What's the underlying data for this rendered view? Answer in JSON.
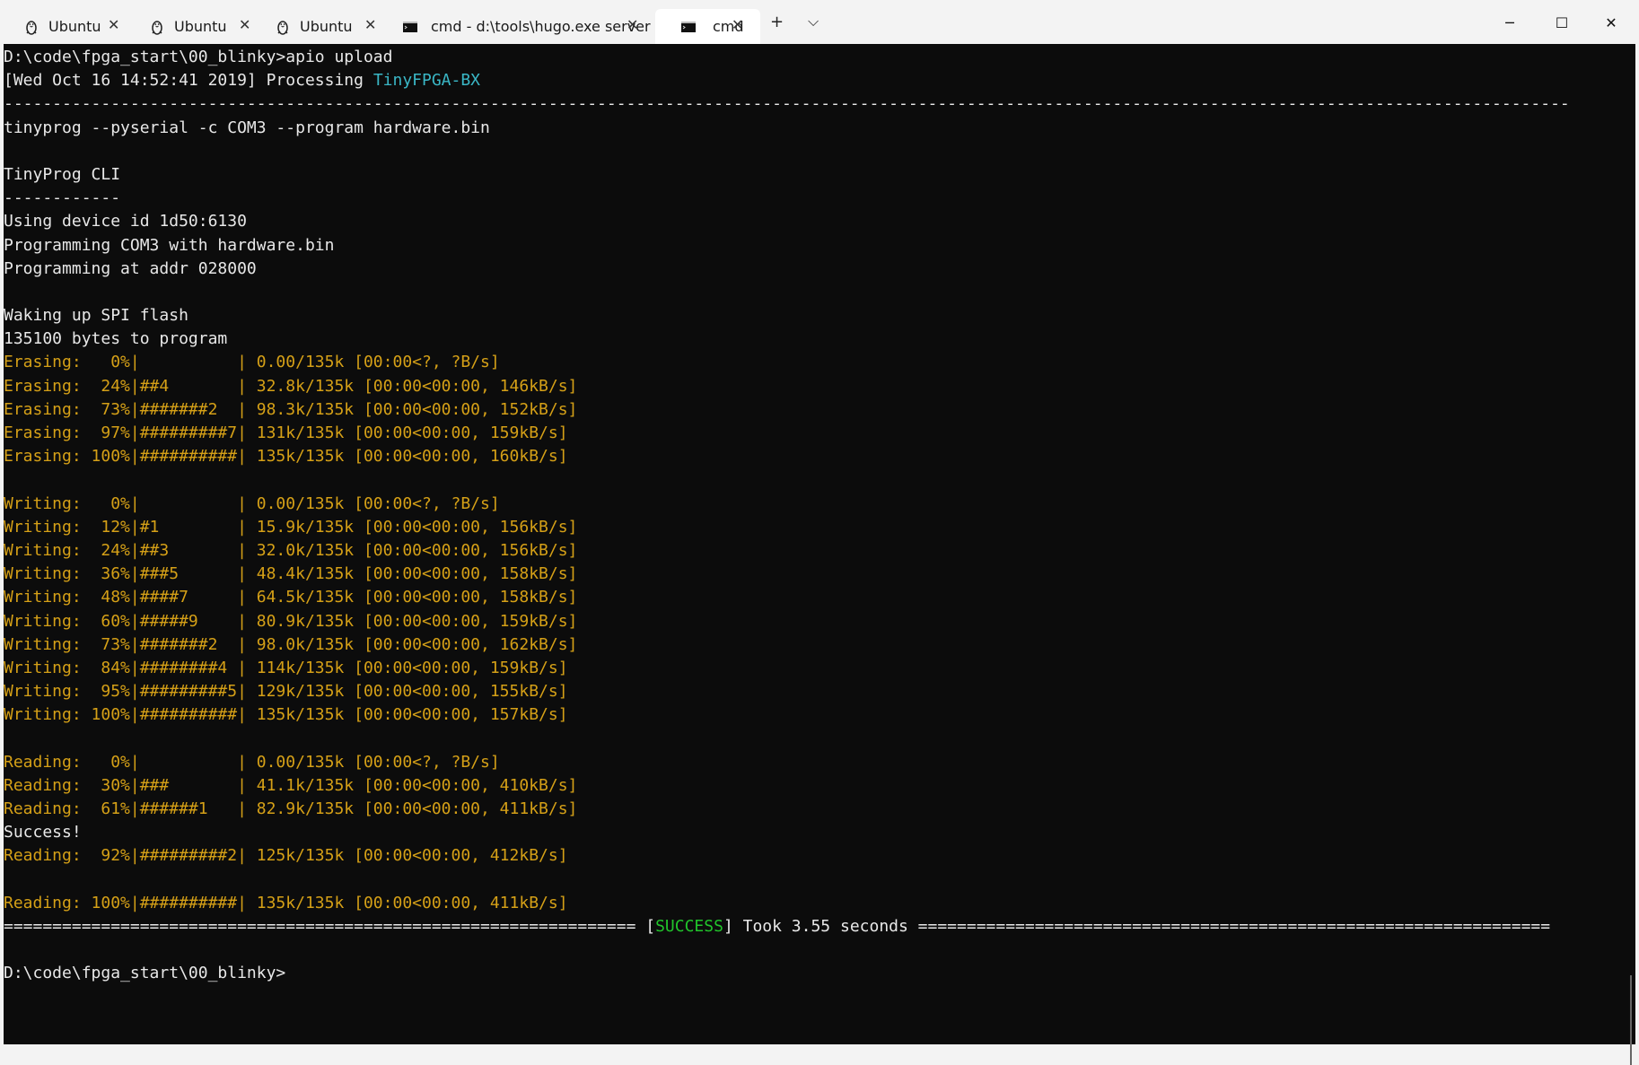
{
  "tabs": [
    {
      "label": "Ubuntu",
      "icon": "linux-penguin-icon"
    },
    {
      "label": "Ubuntu",
      "icon": "linux-penguin-icon"
    },
    {
      "label": "Ubuntu",
      "icon": "linux-penguin-icon"
    },
    {
      "label": "cmd - d:\\tools\\hugo.exe  server",
      "icon": "cmd-console-icon"
    },
    {
      "label": "cmd",
      "icon": "cmd-console-icon",
      "active": true
    }
  ],
  "toolbar": {
    "new_tab": "+",
    "dropdown": "⌵"
  },
  "window_controls": {
    "minimize": "─",
    "maximize": "☐",
    "close": "✕"
  },
  "terminal": {
    "lines": [
      [
        {
          "t": "D:\\code\\fpga_start\\00_blinky>apio upload"
        }
      ],
      [
        {
          "t": "[Wed Oct 16 14:52:41 2019] Processing "
        },
        {
          "t": "TinyFPGA-BX",
          "c": "c"
        }
      ],
      [
        {
          "t": "-----------------------------------------------------------------------------------------------------------------------------------------------------------------"
        }
      ],
      [
        {
          "t": "tinyprog --pyserial -c COM3 --program hardware.bin"
        }
      ],
      [
        {
          "t": ""
        }
      ],
      [
        {
          "t": "TinyProg CLI"
        }
      ],
      [
        {
          "t": "------------"
        }
      ],
      [
        {
          "t": "Using device id 1d50:6130"
        }
      ],
      [
        {
          "t": "Programming COM3 with hardware.bin"
        }
      ],
      [
        {
          "t": "Programming at addr 028000"
        }
      ],
      [
        {
          "t": ""
        }
      ],
      [
        {
          "t": "Waking up SPI flash"
        }
      ],
      [
        {
          "t": "135100 bytes to program"
        }
      ],
      [
        {
          "t": "Erasing:   0%|          | 0.00/135k [00:00<?, ?B/s]",
          "c": "y"
        }
      ],
      [
        {
          "t": "Erasing:  24%|##4       | 32.8k/135k [00:00<00:00, 146kB/s]",
          "c": "y"
        }
      ],
      [
        {
          "t": "Erasing:  73%|#######2  | 98.3k/135k [00:00<00:00, 152kB/s]",
          "c": "y"
        }
      ],
      [
        {
          "t": "Erasing:  97%|#########7| 131k/135k [00:00<00:00, 159kB/s]",
          "c": "y"
        }
      ],
      [
        {
          "t": "Erasing: 100%|##########| 135k/135k [00:00<00:00, 160kB/s]",
          "c": "y"
        }
      ],
      [
        {
          "t": ""
        }
      ],
      [
        {
          "t": "Writing:   0%|          | 0.00/135k [00:00<?, ?B/s]",
          "c": "y"
        }
      ],
      [
        {
          "t": "Writing:  12%|#1        | 15.9k/135k [00:00<00:00, 156kB/s]",
          "c": "y"
        }
      ],
      [
        {
          "t": "Writing:  24%|##3       | 32.0k/135k [00:00<00:00, 156kB/s]",
          "c": "y"
        }
      ],
      [
        {
          "t": "Writing:  36%|###5      | 48.4k/135k [00:00<00:00, 158kB/s]",
          "c": "y"
        }
      ],
      [
        {
          "t": "Writing:  48%|####7     | 64.5k/135k [00:00<00:00, 158kB/s]",
          "c": "y"
        }
      ],
      [
        {
          "t": "Writing:  60%|#####9    | 80.9k/135k [00:00<00:00, 159kB/s]",
          "c": "y"
        }
      ],
      [
        {
          "t": "Writing:  73%|#######2  | 98.0k/135k [00:00<00:00, 162kB/s]",
          "c": "y"
        }
      ],
      [
        {
          "t": "Writing:  84%|########4 | 114k/135k [00:00<00:00, 159kB/s]",
          "c": "y"
        }
      ],
      [
        {
          "t": "Writing:  95%|#########5| 129k/135k [00:00<00:00, 155kB/s]",
          "c": "y"
        }
      ],
      [
        {
          "t": "Writing: 100%|##########| 135k/135k [00:00<00:00, 157kB/s]",
          "c": "y"
        }
      ],
      [
        {
          "t": ""
        }
      ],
      [
        {
          "t": "Reading:   0%|          | 0.00/135k [00:00<?, ?B/s]",
          "c": "y"
        }
      ],
      [
        {
          "t": "Reading:  30%|###       | 41.1k/135k [00:00<00:00, 410kB/s]",
          "c": "y"
        }
      ],
      [
        {
          "t": "Reading:  61%|######1   | 82.9k/135k [00:00<00:00, 411kB/s]",
          "c": "y"
        }
      ],
      [
        {
          "t": "Success!"
        }
      ],
      [
        {
          "t": "Reading:  92%|#########2| 125k/135k [00:00<00:00, 412kB/s]",
          "c": "y"
        }
      ],
      [
        {
          "t": ""
        }
      ],
      [
        {
          "t": "Reading: 100%|##########| 135k/135k [00:00<00:00, 411kB/s]",
          "c": "y"
        }
      ],
      [
        {
          "t": "================================================================= ["
        },
        {
          "t": "SUCCESS",
          "c": "g"
        },
        {
          "t": "] Took 3.55 seconds ================================================================="
        }
      ],
      [
        {
          "t": ""
        }
      ],
      [
        {
          "t": "D:\\code\\fpga_start\\00_blinky>"
        }
      ]
    ]
  }
}
